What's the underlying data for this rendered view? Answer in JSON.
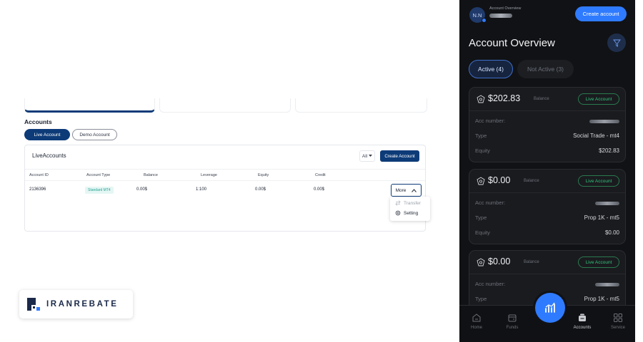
{
  "desktop": {
    "accounts_title": "Accounts",
    "tabs": {
      "live": "Live Account",
      "demo": "Demo Account"
    },
    "table": {
      "title": "LiveAccounts",
      "filter": "All",
      "create_button": "Create Account",
      "headers": [
        "Account ID",
        "Account Type",
        "Balance",
        "Leverage",
        "Equity",
        "Credit"
      ],
      "row": {
        "account_id": "2136396",
        "account_type": "Standard MT4",
        "balance": "0.00$",
        "leverage": "1:100",
        "equity": "0.00$",
        "credit": "0.00$"
      },
      "more_button": "More",
      "menu": {
        "transfer": "Transfer",
        "setting": "Setting"
      }
    },
    "logo_text": "IRANREBATE"
  },
  "mobile": {
    "avatar": "N.N",
    "header_label": "Account Overview",
    "create_button": "Create account",
    "title": "Account Overview",
    "segments": {
      "active": "Active (4)",
      "inactive": "Not Active (3)"
    },
    "cards": [
      {
        "balance": "$202.83",
        "balance_label": "Balance",
        "badge": "Live Account",
        "acc_label": "Acc number:",
        "type_label": "Type",
        "type": "Social Trade - mt4",
        "equity_label": "Equity",
        "equity": "$202.83"
      },
      {
        "balance": "$0.00",
        "balance_label": "Balance",
        "badge": "Live Account",
        "acc_label": "Acc number:",
        "type_label": "Type",
        "type": "Prop 1K - mt5",
        "equity_label": "Equity",
        "equity": "$0.00"
      },
      {
        "balance": "$0.00",
        "balance_label": "Balance",
        "badge": "Live Account",
        "acc_label": "Acc number:",
        "type_label": "Type",
        "type": "Prop 1K - mt5"
      }
    ],
    "nav": {
      "home": "Home",
      "funds": "Funds",
      "accounts": "Accounts",
      "service": "Service"
    }
  },
  "colors": {
    "brand_navy": "#0d3b78",
    "mobile_bg": "#111215",
    "accent_blue": "#2f7bff",
    "live_green": "#33c27a"
  }
}
